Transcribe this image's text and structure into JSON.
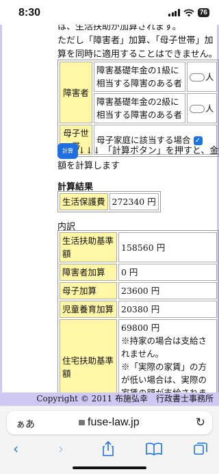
{
  "status_bar": {
    "time": "8:30",
    "battery": "76"
  },
  "intro_text": {
    "line1": "は、生活扶助が加算されます。",
    "line2": "ただし「障害者」加算、「母子世帯」加算を同時に適用することはできません。"
  },
  "conditions": {
    "disabled_label": "障害者",
    "disabled_grade1": "障害基礎年金の1級に相当する障害のある者",
    "disabled_grade2": "障害基礎年金の2級に相当する障害のある者",
    "unit": "人",
    "single_mother_label": "母子世帯",
    "single_mother_desc": "母子家庭に該当する場合",
    "single_mother_checked": true
  },
  "calc": {
    "button_label": "計算",
    "arrows": "↓↓↓",
    "instruction": "「計算ボタン」を押すと、金額を計算します"
  },
  "result": {
    "heading": "計算結果",
    "label": "生活保護費",
    "value": "272340",
    "unit": "円"
  },
  "breakdown": {
    "heading": "内訳",
    "rows": [
      {
        "label": "生活扶助基準額",
        "value": "158560 円"
      },
      {
        "label": "障害者加算",
        "value": "0 円"
      },
      {
        "label": "母子加算",
        "value": "23600 円"
      },
      {
        "label": "児童養育加算",
        "value": "20380 円"
      }
    ],
    "housing": {
      "label": "住宅扶助基準額",
      "value": "69800 円",
      "note1": "※持家の場合は支給されません。",
      "note2": "※「実際の家賃」の方が低い場合は、実際の家賃の額が支給されます。"
    }
  },
  "footer": {
    "copyright": "Copyright © 2011 布施弘幸　行政書士事務所"
  },
  "browser": {
    "aa_label": "ぁあ",
    "domain": "fuse-law.jp"
  },
  "colors": {
    "accent": "#1a73e8",
    "highlight": "#fff6a6",
    "frame": "#cfc8f2"
  }
}
